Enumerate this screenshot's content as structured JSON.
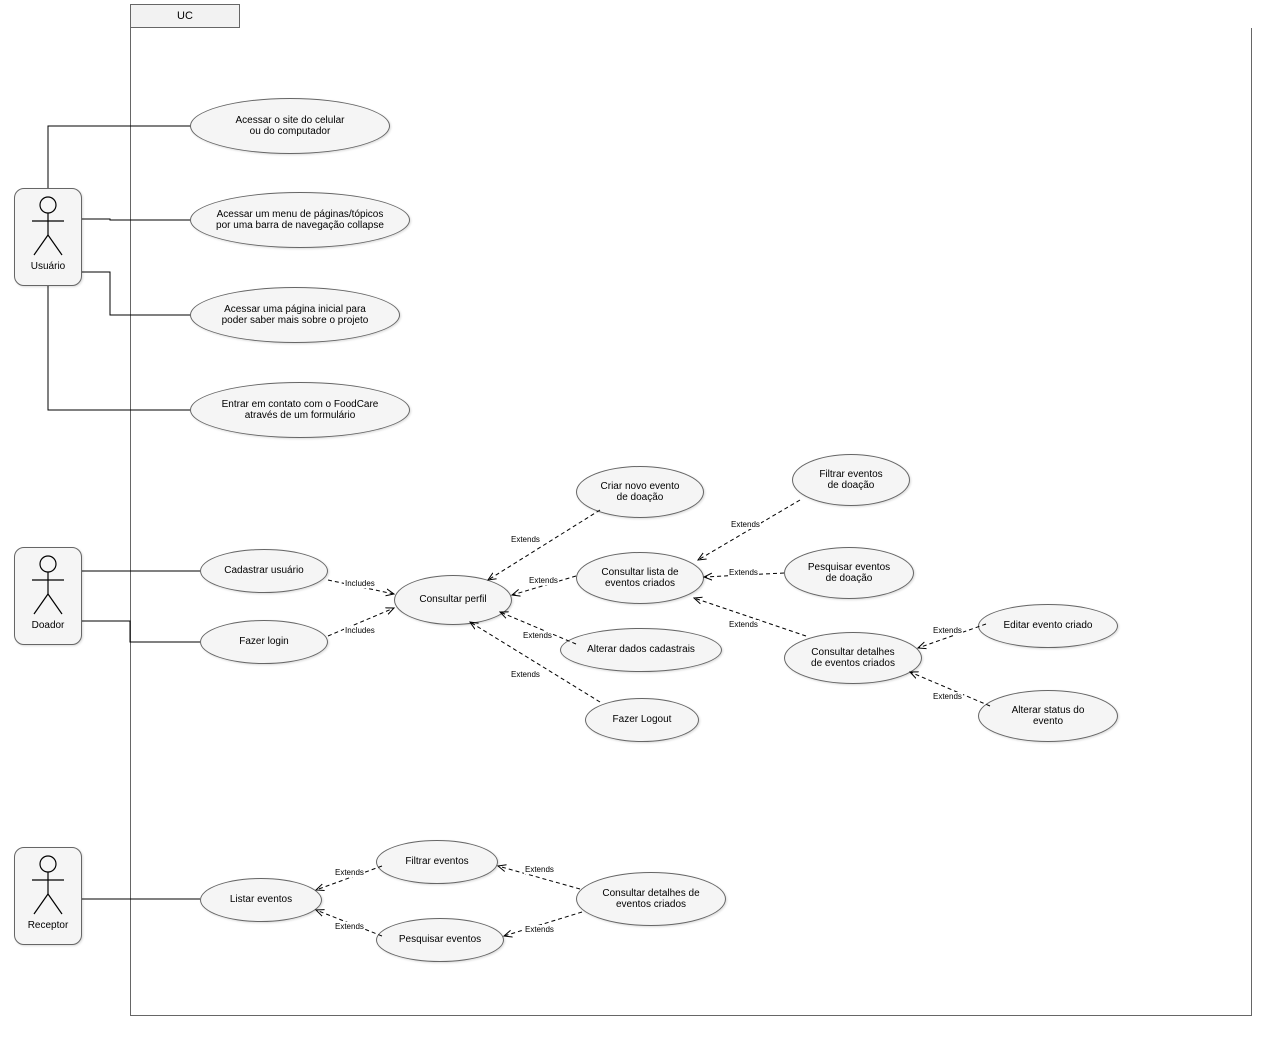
{
  "frame": {
    "title": "UC"
  },
  "actors": {
    "usuario": {
      "label": "Usuário"
    },
    "doador": {
      "label": "Doador"
    },
    "receptor": {
      "label": "Receptor"
    }
  },
  "usecases": {
    "uc_acessar_site": {
      "label": "Acessar o site do celular\nou do computador"
    },
    "uc_menu_paginas": {
      "label": "Acessar um menu de páginas/tópicos\npor uma barra de navegação collapse"
    },
    "uc_pagina_inicial": {
      "label": "Acessar uma página inicial para\npoder saber mais sobre o projeto"
    },
    "uc_contato_foodcare": {
      "label": "Entrar em contato com o FoodCare\natravés de um formulário"
    },
    "uc_cadastrar_usuario": {
      "label": "Cadastrar usuário"
    },
    "uc_fazer_login": {
      "label": "Fazer login"
    },
    "uc_consultar_perfil": {
      "label": "Consultar perfil"
    },
    "uc_criar_evento": {
      "label": "Criar novo evento\nde doação"
    },
    "uc_consultar_lista": {
      "label": "Consultar lista de\neventos criados"
    },
    "uc_alterar_dados": {
      "label": "Alterar dados cadastrais"
    },
    "uc_fazer_logout": {
      "label": "Fazer Logout"
    },
    "uc_filtrar_doacao": {
      "label": "Filtrar eventos\nde doação"
    },
    "uc_pesquisar_doacao": {
      "label": "Pesquisar eventos\nde doação"
    },
    "uc_consultar_detalhes": {
      "label": "Consultar detalhes\nde eventos criados"
    },
    "uc_editar_evento": {
      "label": "Editar evento criado"
    },
    "uc_alterar_status": {
      "label": "Alterar status do\nevento"
    },
    "uc_listar_eventos": {
      "label": "Listar eventos"
    },
    "uc_filtrar_eventos": {
      "label": "Filtrar eventos"
    },
    "uc_pesquisar_eventos": {
      "label": "Pesquisar eventos"
    },
    "uc_consultar_detalhes2": {
      "label": "Consultar detalhes de\neventos criados"
    }
  },
  "edgeLabels": {
    "includes": "Includes",
    "extends": "Extends"
  }
}
